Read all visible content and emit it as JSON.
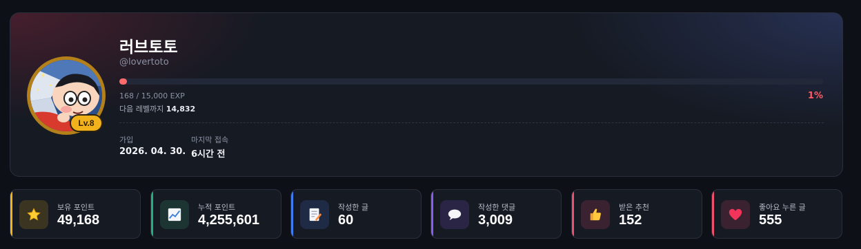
{
  "profile": {
    "username": "러브토토",
    "handle": "@lovertoto",
    "level": "Lv.8",
    "exp_text": "168 / 15,000 EXP",
    "exp_fraction": 0.0112,
    "exp_percent": "1%",
    "next_level_label": "다음 레벨까지",
    "next_level_value": "14,832",
    "joined_label": "가입",
    "joined_value": "2026. 04. 30.",
    "last_access_label": "마지막 접속",
    "last_access_value": "6시간 전",
    "colors": {
      "exp_bar": "#ff6b6b",
      "level_badge": "#f2b21c",
      "percent": "#ff5b66"
    }
  },
  "stats": [
    {
      "label": "보유 포인트",
      "value": "49,168",
      "icon": "star-icon",
      "accent": "#f5b416",
      "icon_bg": "#3a3420"
    },
    {
      "label": "누적 포인트",
      "value": "4,255,601",
      "icon": "chart-increasing-icon",
      "accent": "#22b07d",
      "icon_bg": "#1c3532"
    },
    {
      "label": "작성한 글",
      "value": "60",
      "icon": "memo-icon",
      "accent": "#3d7cf2",
      "icon_bg": "#1f2b45"
    },
    {
      "label": "작성한 댓글",
      "value": "3,009",
      "icon": "speech-bubble-icon",
      "accent": "#8a5cf2",
      "icon_bg": "#2a2545"
    },
    {
      "label": "받은 추천",
      "value": "152",
      "icon": "thumbs-up-icon",
      "accent": "#f0506e",
      "icon_bg": "#3a2230"
    },
    {
      "label": "좋아요 누른 글",
      "value": "555",
      "icon": "heart-icon",
      "accent": "#f0506e",
      "icon_bg": "#3a2230"
    }
  ]
}
